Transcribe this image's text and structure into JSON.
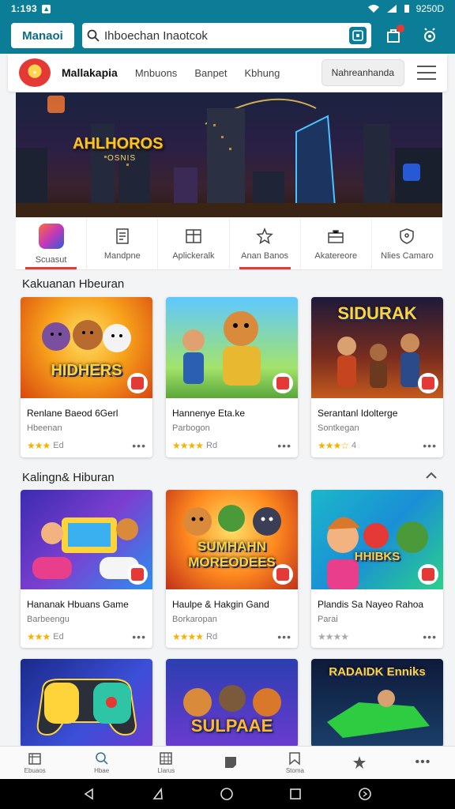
{
  "status": {
    "time": "1:193",
    "right_text": "9250D"
  },
  "appbar": {
    "brand": "Manaoi",
    "search_value": "Ihboechan Inaotcok"
  },
  "nav": {
    "title": "Mallakapia",
    "links": [
      "Mnbuons",
      "Banpet",
      "Kbhung"
    ],
    "cta": "Nahreanhanda"
  },
  "banner": {
    "title": "AHLHOROS",
    "subtitle": "OSNIS"
  },
  "categories": [
    {
      "label": "Scuasut",
      "icon": "app-icon"
    },
    {
      "label": "Mandpne",
      "icon": "document-icon"
    },
    {
      "label": "Aplickeralk",
      "icon": "table-icon"
    },
    {
      "label": "Anan Banos",
      "icon": "star-icon"
    },
    {
      "label": "Akatereore",
      "icon": "briefcase-icon"
    },
    {
      "label": "Nlies Camaro",
      "icon": "shield-icon"
    }
  ],
  "section1": {
    "title": "Kakuanan Hbeuran",
    "cards": [
      {
        "thumb_text": "HIDHERS",
        "name": "Renlane Baeod 6Gerl",
        "sub": "Hbeenan",
        "stars": "★★★",
        "rating": "Ed"
      },
      {
        "thumb_text": "",
        "name": "Hannenye Eta.ke",
        "sub": "Parbogon",
        "stars": "★★★★",
        "rating": "Rd"
      },
      {
        "thumb_text": "SIDURAK",
        "name": "Serantanl Idolterge",
        "sub": "Sontkegan",
        "stars": "★★★☆",
        "rating": "4"
      }
    ]
  },
  "section2": {
    "title": "Kalingn& Hiburan",
    "cards": [
      {
        "thumb_text": "",
        "name": "Hananak Hbuans Game",
        "sub": "Barbeengu",
        "stars": "★★★",
        "rating": "Ed"
      },
      {
        "thumb_text": "SUMHAHN MOREODEES",
        "name": "Haulpe & Hakgin Gand",
        "sub": "Borkaropan",
        "stars": "★★★★",
        "rating": "Rd"
      },
      {
        "thumb_text": "HHIBKS",
        "name": "Plandis Sa Nayeo Rahoa",
        "sub": "Parai",
        "stars": "★★★★",
        "rating": ""
      }
    ]
  },
  "section3": {
    "cards": [
      {
        "thumb_text": ""
      },
      {
        "thumb_text": "SULPAAE"
      },
      {
        "thumb_text": "RADAIDK Enniks"
      }
    ]
  },
  "bottomnav": [
    {
      "label": "Ebuaos",
      "icon": "home-icon"
    },
    {
      "label": "Hbae",
      "icon": "search-icon"
    },
    {
      "label": "Llarus",
      "icon": "grid-icon"
    },
    {
      "label": "",
      "icon": "note-icon"
    },
    {
      "label": "Stoma",
      "icon": "bookmark-icon"
    },
    {
      "label": "",
      "icon": "star-icon"
    },
    {
      "label": "",
      "icon": "more-icon"
    }
  ],
  "colors": {
    "primary": "#0c7d96",
    "accent": "#e53935",
    "star": "#f5b301"
  }
}
